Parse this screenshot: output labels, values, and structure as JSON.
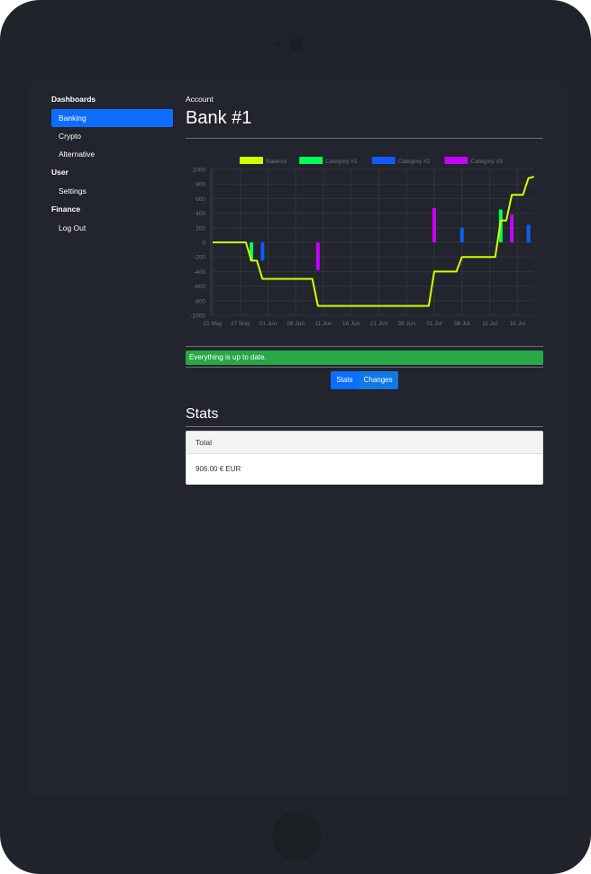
{
  "sidebar": {
    "groups": [
      {
        "heading": "Dashboards",
        "items": [
          {
            "label": "Banking",
            "active": true
          },
          {
            "label": "Crypto"
          },
          {
            "label": "Alternative"
          }
        ]
      },
      {
        "heading": "User",
        "items": [
          {
            "label": "Settings"
          }
        ]
      },
      {
        "heading": "Finance",
        "items": [
          {
            "label": "Log Out"
          }
        ]
      }
    ]
  },
  "main": {
    "eyebrow": "Account",
    "title": "Bank #1",
    "alert": "Everything is up to date.",
    "buttons": {
      "stats": "Stats",
      "changes": "Changes"
    },
    "stats_title": "Stats",
    "card": {
      "header": "Total",
      "value": "906.00 € EUR"
    }
  },
  "colors": {
    "accent": "#0d6efd",
    "success": "#28a745",
    "balance": "#d4ff00",
    "category1": "#00ff55",
    "category2": "#0d5cff",
    "category3": "#c800ff"
  },
  "chart_data": {
    "type": "line",
    "legend_position": "top",
    "grid": true,
    "ylim": [
      -1000,
      1000
    ],
    "y_ticks": [
      1000,
      800,
      600,
      400,
      200,
      0,
      -200,
      -400,
      -600,
      -800,
      -1000
    ],
    "x_ticks": [
      "22 May",
      "27 May",
      "01 Jun",
      "06 Jun",
      "11 Jun",
      "16 Jun",
      "21 Jun",
      "26 Jun",
      "01 Jul",
      "06 Jul",
      "11 Jul",
      "16 Jul"
    ],
    "start_date": "2023-05-22",
    "series": [
      {
        "name": "Balance",
        "kind": "line",
        "color": "#d4ff00",
        "points": [
          [
            "2023-05-22",
            0
          ],
          [
            "2023-05-28",
            0
          ],
          [
            "2023-05-29",
            -250
          ],
          [
            "2023-05-30",
            -250
          ],
          [
            "2023-05-31",
            -500
          ],
          [
            "2023-06-09",
            -500
          ],
          [
            "2023-06-10",
            -870
          ],
          [
            "2023-06-30",
            -870
          ],
          [
            "2023-07-01",
            -400
          ],
          [
            "2023-07-05",
            -400
          ],
          [
            "2023-07-06",
            -200
          ],
          [
            "2023-07-12",
            -200
          ],
          [
            "2023-07-13",
            300
          ],
          [
            "2023-07-14",
            300
          ],
          [
            "2023-07-15",
            650
          ],
          [
            "2023-07-17",
            650
          ],
          [
            "2023-07-18",
            880
          ],
          [
            "2023-07-19",
            900
          ]
        ]
      },
      {
        "name": "Category #1",
        "kind": "bar",
        "color": "#00ff55",
        "bars": [
          [
            "2023-05-29",
            -250
          ],
          [
            "2023-07-13",
            450
          ]
        ]
      },
      {
        "name": "Category #2",
        "kind": "bar",
        "color": "#0d5cff",
        "bars": [
          [
            "2023-05-31",
            -250
          ],
          [
            "2023-07-06",
            200
          ],
          [
            "2023-07-18",
            240
          ]
        ]
      },
      {
        "name": "Category #3",
        "kind": "bar",
        "color": "#c800ff",
        "bars": [
          [
            "2023-06-10",
            -380
          ],
          [
            "2023-07-01",
            470
          ],
          [
            "2023-07-15",
            380
          ]
        ]
      }
    ]
  }
}
